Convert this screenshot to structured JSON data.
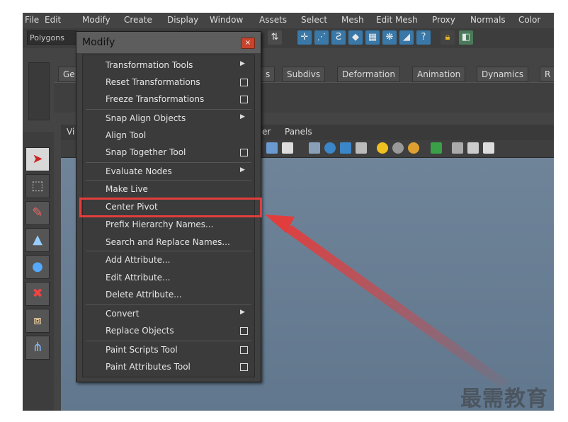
{
  "menubar": [
    "File",
    "Edit",
    "Modify",
    "Create",
    "Display",
    "Window",
    "Assets",
    "Select",
    "Mesh",
    "Edit Mesh",
    "Proxy",
    "Normals",
    "Color"
  ],
  "toolbar": {
    "mode": "Polygons"
  },
  "shelf_tabs": [
    "Ge",
    "s",
    "Subdivs",
    "Deformation",
    "Animation",
    "Dynamics",
    "R"
  ],
  "panel_menu": [
    "Vi",
    "er",
    "Panels"
  ],
  "menu": {
    "title": "Modify",
    "close_glyph": "×",
    "items": [
      {
        "label": "Transformation Tools",
        "suffix": "arrow"
      },
      {
        "label": "Reset Transformations",
        "suffix": "option"
      },
      {
        "label": "Freeze Transformations",
        "suffix": "option"
      },
      {
        "label": "Snap Align Objects",
        "suffix": "arrow"
      },
      {
        "label": "Align Tool",
        "suffix": ""
      },
      {
        "label": "Snap Together Tool",
        "suffix": "option"
      },
      {
        "label": "Evaluate Nodes",
        "suffix": "arrow"
      },
      {
        "label": "Make Live",
        "suffix": ""
      },
      {
        "label": "Center Pivot",
        "suffix": ""
      },
      {
        "label": "Prefix Hierarchy Names...",
        "suffix": ""
      },
      {
        "label": "Search and Replace Names...",
        "suffix": ""
      },
      {
        "label": "Add Attribute...",
        "suffix": ""
      },
      {
        "label": "Edit Attribute...",
        "suffix": ""
      },
      {
        "label": "Delete Attribute...",
        "suffix": ""
      },
      {
        "label": "Convert",
        "suffix": "arrow"
      },
      {
        "label": "Replace Objects",
        "suffix": "option"
      },
      {
        "label": "Paint Scripts Tool",
        "suffix": "option"
      },
      {
        "label": "Paint Attributes Tool",
        "suffix": "option"
      }
    ]
  },
  "annotation": {
    "highlight_color": "#e23d3d",
    "target_item": "Center Pivot"
  },
  "watermark": "最需教育",
  "icons": [
    "move-icon",
    "lasso-icon",
    "paint-icon",
    "cone-icon",
    "sphere-icon",
    "scale-icon",
    "cube-icon",
    "help-icon",
    "lock-icon"
  ]
}
